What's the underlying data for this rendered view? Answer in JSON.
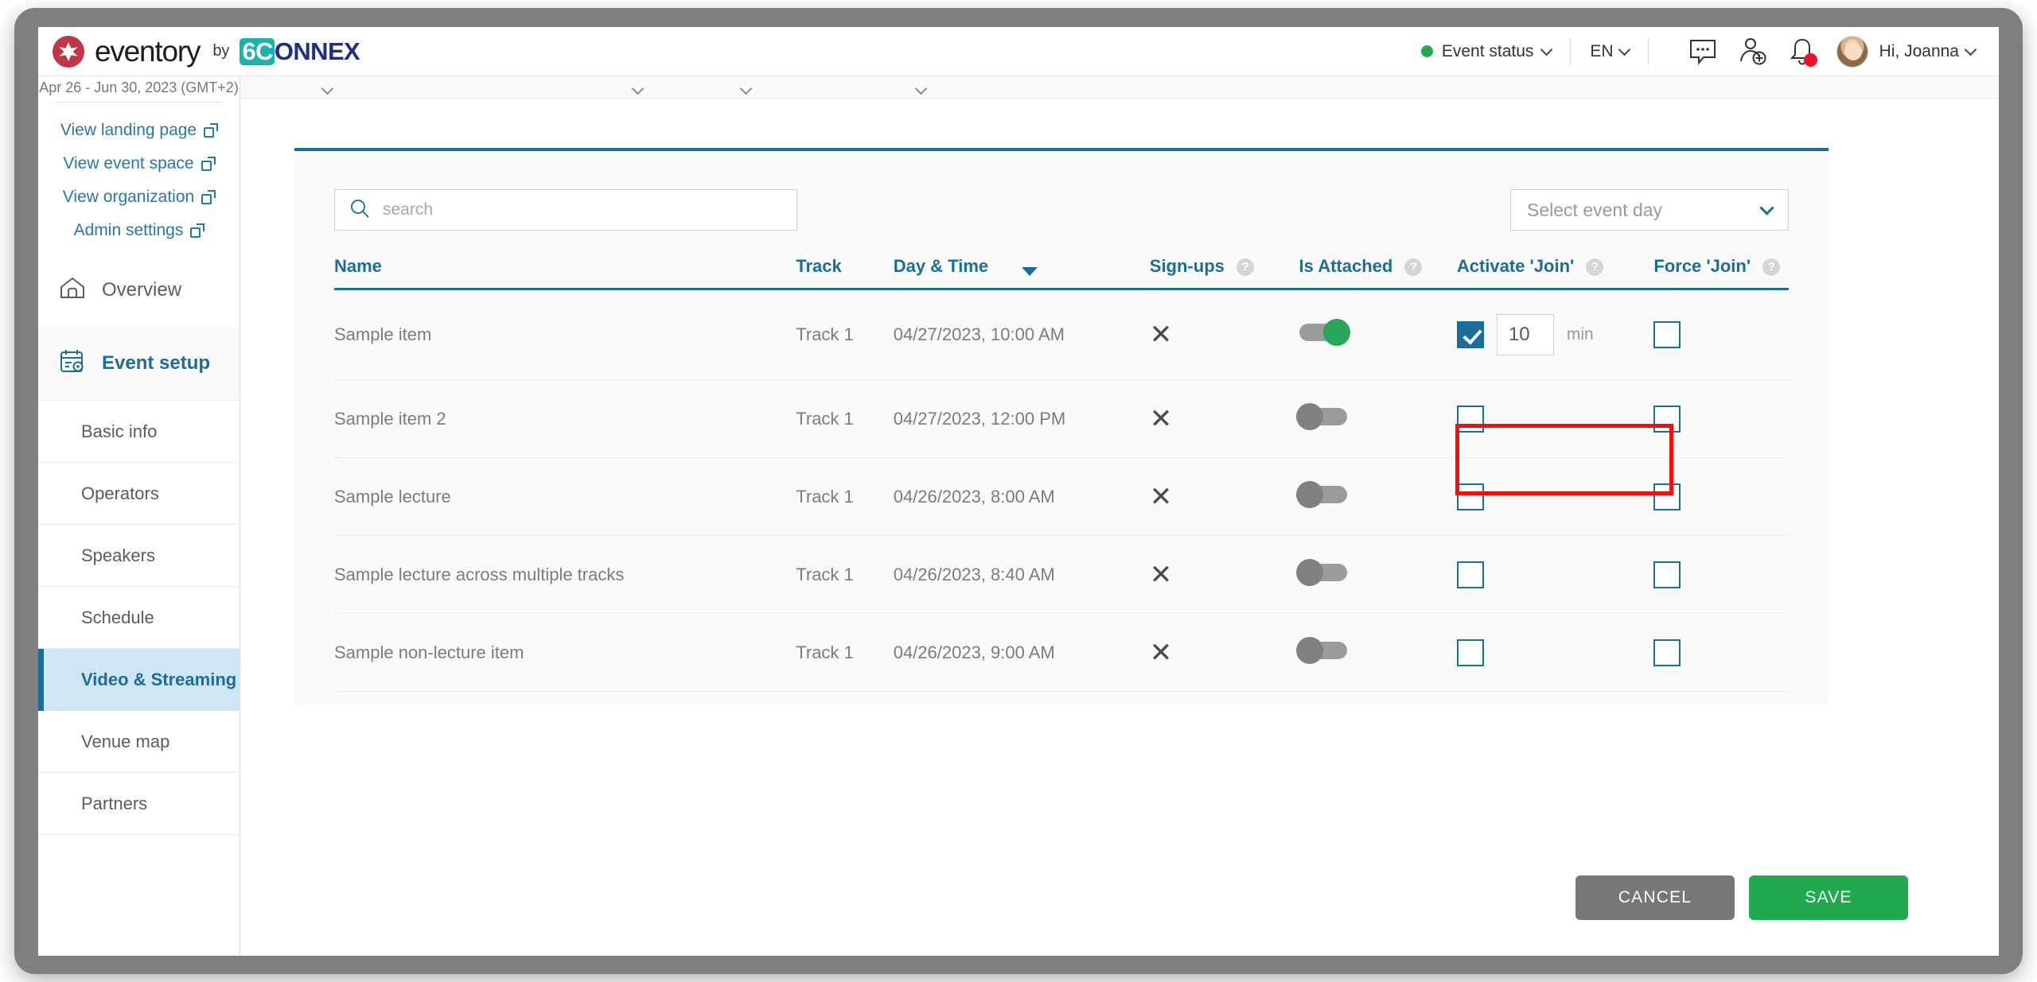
{
  "header": {
    "brand_name": "eventory",
    "brand_by": "by",
    "brand_partner_prefix": "6C",
    "brand_partner_suffix": "ONNEX",
    "event_status_label": "Event status",
    "event_status_color": "#22a84f",
    "language": "EN",
    "greeting": "Hi, Joanna",
    "icons": {
      "chat": "chat-bubble-icon",
      "add_people": "add-people-icon",
      "notifications": "bell-icon",
      "avatar": "user-avatar"
    }
  },
  "sidebar": {
    "event_dates": "Apr 26 - Jun 30, 2023 (GMT+2)",
    "external_links": [
      {
        "label": "View landing page",
        "icon": "external-link-icon"
      },
      {
        "label": "View event space",
        "icon": "external-link-icon"
      },
      {
        "label": "View organization",
        "icon": "external-link-icon"
      },
      {
        "label": "Admin settings",
        "icon": "external-link-icon"
      }
    ],
    "nav": [
      {
        "label": "Overview",
        "icon": "home-icon",
        "active": false
      },
      {
        "label": "Event setup",
        "icon": "calendar-gear-icon",
        "active": true
      }
    ],
    "sub_items": [
      {
        "label": "Basic info",
        "selected": false
      },
      {
        "label": "Operators",
        "selected": false
      },
      {
        "label": "Speakers",
        "selected": false
      },
      {
        "label": "Schedule",
        "selected": false
      },
      {
        "label": "Video & Streaming",
        "selected": true
      },
      {
        "label": "Venue map",
        "selected": false
      },
      {
        "label": "Partners",
        "selected": false
      }
    ]
  },
  "main": {
    "search": {
      "placeholder": "search",
      "value": "",
      "icon": "search-icon"
    },
    "event_day_select": {
      "placeholder": "Select event day",
      "value": "",
      "icon": "chevron-down-icon"
    },
    "table": {
      "columns": [
        {
          "label": "Name",
          "help": false,
          "sorted": false
        },
        {
          "label": "Track",
          "help": false,
          "sorted": false
        },
        {
          "label": "Day & Time",
          "help": false,
          "sorted": true
        },
        {
          "label": "Sign-ups",
          "help": true,
          "sorted": false
        },
        {
          "label": "Is Attached",
          "help": true,
          "sorted": false
        },
        {
          "label": "Activate 'Join'",
          "help": true,
          "sorted": false
        },
        {
          "label": "Force 'Join'",
          "help": true,
          "sorted": false
        }
      ],
      "help_glyph": "?",
      "rows": [
        {
          "name": "Sample item",
          "track": "Track 1",
          "day_time": "04/27/2023, 10:00 AM",
          "signups": "✕",
          "is_attached": true,
          "activate_join": true,
          "join_minutes": "10",
          "minutes_unit": "min",
          "force_join": false,
          "highlighted": true
        },
        {
          "name": "Sample item 2",
          "track": "Track 1",
          "day_time": "04/27/2023, 12:00 PM",
          "signups": "✕",
          "is_attached": false,
          "activate_join": false,
          "join_minutes": "",
          "minutes_unit": "",
          "force_join": false,
          "highlighted": false
        },
        {
          "name": "Sample lecture",
          "track": "Track 1",
          "day_time": "04/26/2023, 8:00 AM",
          "signups": "✕",
          "is_attached": false,
          "activate_join": false,
          "join_minutes": "",
          "minutes_unit": "",
          "force_join": false,
          "highlighted": false
        },
        {
          "name": "Sample lecture across multiple tracks",
          "track": "Track 1",
          "day_time": "04/26/2023, 8:40 AM",
          "signups": "✕",
          "is_attached": false,
          "activate_join": false,
          "join_minutes": "",
          "minutes_unit": "",
          "force_join": false,
          "highlighted": false
        },
        {
          "name": "Sample non-lecture item",
          "track": "Track 1",
          "day_time": "04/26/2023, 9:00 AM",
          "signups": "✕",
          "is_attached": false,
          "activate_join": false,
          "join_minutes": "",
          "minutes_unit": "",
          "force_join": false,
          "highlighted": false
        }
      ]
    },
    "buttons": {
      "cancel": "CANCEL",
      "save": "SAVE"
    },
    "annotation": {
      "type": "red-highlight-box",
      "color": "#f50c0c",
      "target": "activate-join-cell-row-1"
    }
  },
  "colors": {
    "accent_blue": "#1b6e9a",
    "link_blue": "#2479ab",
    "green": "#22a84f",
    "grey": "#777777",
    "highlight_red": "#f50c0c",
    "selected_nav_bg": "#cfe7f5"
  }
}
